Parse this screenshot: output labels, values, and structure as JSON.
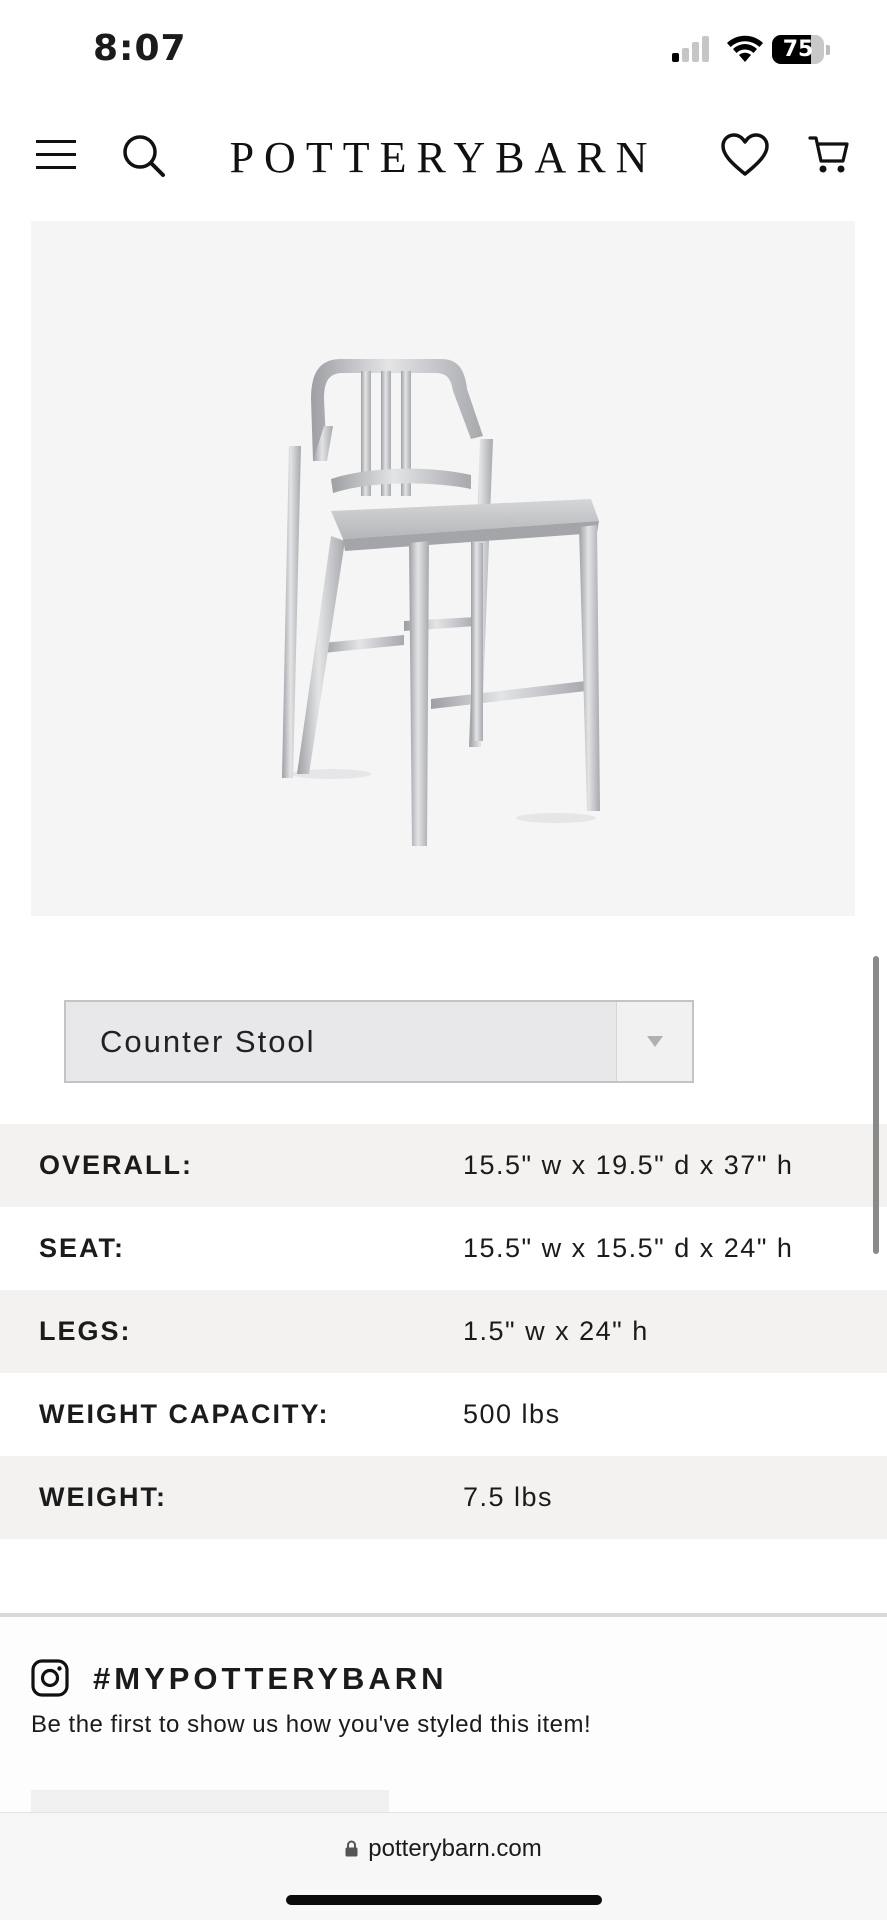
{
  "status_bar": {
    "time": "8:07",
    "battery_level": "75",
    "signal_bars_active": 1,
    "signal_bars_total": 4,
    "battery_fraction": 0.75
  },
  "header": {
    "brand": "POTTERYBARN",
    "icons": [
      "menu-icon",
      "search-icon",
      "heart-icon",
      "cart-icon"
    ]
  },
  "product": {
    "image_alt": "Aluminum counter stool"
  },
  "size_select": {
    "value": "Counter Stool"
  },
  "dimensions": {
    "rows": [
      {
        "label": "OVERALL:",
        "value": "15.5\" w x 19.5\" d x 37\" h"
      },
      {
        "label": "SEAT:",
        "value": "15.5\" w x 15.5\" d x 24\" h"
      },
      {
        "label": "LEGS:",
        "value": "1.5\" w x 24\" h"
      },
      {
        "label": "WEIGHT CAPACITY:",
        "value": "500 lbs"
      },
      {
        "label": "WEIGHT:",
        "value": "7.5 lbs"
      }
    ]
  },
  "social": {
    "title": "#MYPOTTERYBARN",
    "subtitle": "Be the first to show us how you've styled this item!"
  },
  "browser": {
    "url": "potterybarn.com"
  },
  "colors": {
    "text": "#1b1b1b",
    "row_shade": "#f3f2f1",
    "image_bg": "#f5f5f6",
    "select_bg": "#e8e8ea"
  }
}
